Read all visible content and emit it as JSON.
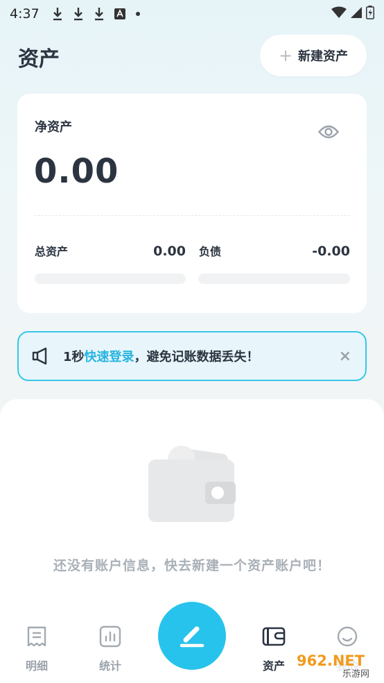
{
  "status_bar": {
    "time": "4:37"
  },
  "header": {
    "title": "资产",
    "new_button_label": "新建资产"
  },
  "summary": {
    "net_label": "净资产",
    "net_value": "0.00",
    "total_label": "总资产",
    "total_value": "0.00",
    "debt_label": "负债",
    "debt_value": "-0.00"
  },
  "notice": {
    "prefix": "1秒",
    "link": "快速登录",
    "suffix": "，避免记账数据丢失！",
    "close": "×"
  },
  "empty_state": {
    "message": "还没有账户信息，快去新建一个资产账户吧！"
  },
  "tabs": [
    {
      "label": "明细",
      "icon": "receipt-icon"
    },
    {
      "label": "统计",
      "icon": "chart-icon"
    },
    {
      "label": "资产",
      "icon": "wallet-icon",
      "active": true
    },
    {
      "label": "我的",
      "icon": "profile-icon"
    }
  ],
  "watermark": {
    "text": "962.NET",
    "sub": "乐游网"
  },
  "colors": {
    "accent": "#28c3ec",
    "link": "#27b4e0",
    "notice_border": "#35c7e8"
  }
}
